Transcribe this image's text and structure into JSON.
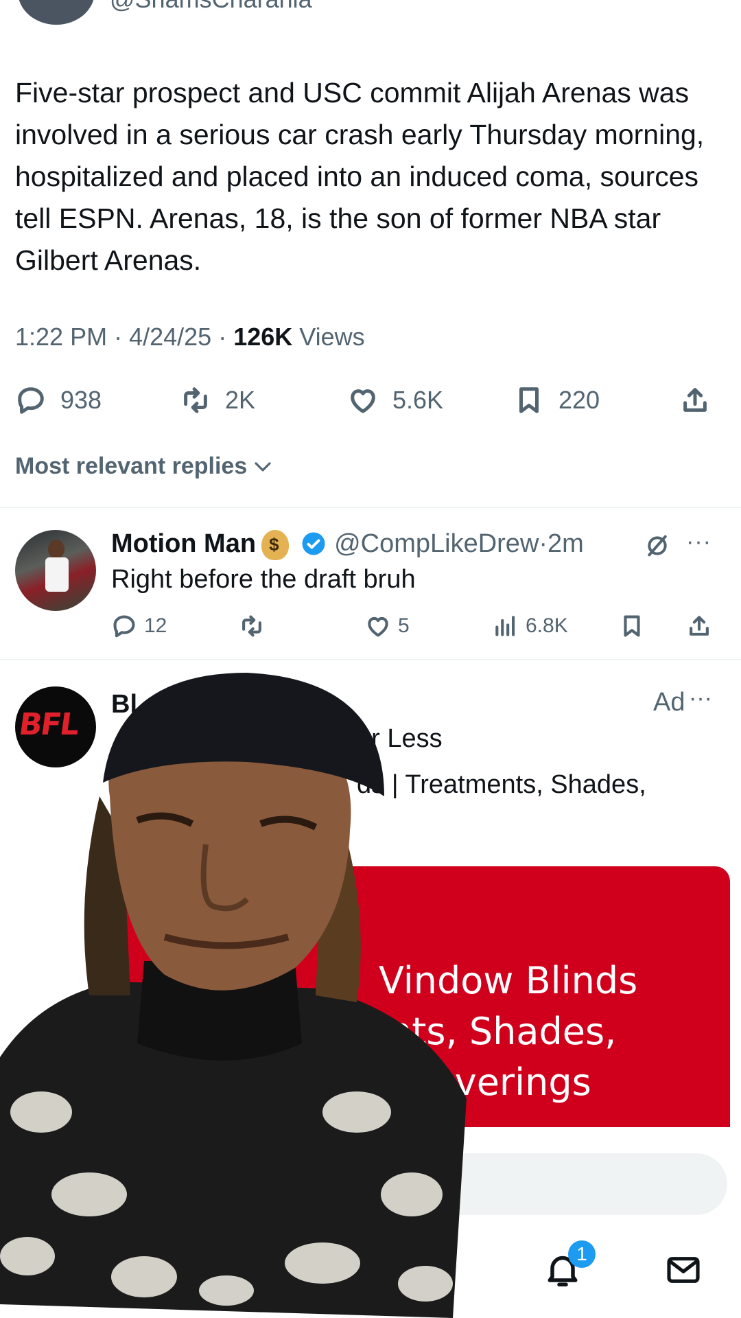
{
  "tweet": {
    "handle": "@ShamsCharania",
    "text": "Five-star prospect and USC commit Alijah Arenas was involved in a serious car crash early Thursday morning, hospitalized and placed into an induced coma, sources tell ESPN. Arenas, 18, is the son of former NBA star Gilbert Arenas.",
    "time": "1:22 PM",
    "date": "4/24/25",
    "views_count": "126K",
    "views_label": "Views",
    "replies": "938",
    "reposts": "2K",
    "likes": "5.6K",
    "bookmarks": "220"
  },
  "replies_sort": {
    "label": "Most relevant replies"
  },
  "reply": {
    "name": "Motion Man",
    "handle": "@CompLikeDrew",
    "age": "2m",
    "text": "Right before the draft bruh",
    "replies": "12",
    "likes": "5",
    "views": "6.8K"
  },
  "ad": {
    "name_partial": "Bl",
    "label": "Ad",
    "line1_partial": "or Less",
    "line2_partial": "ds | Treatments, Shades,",
    "avatar_logo": "BFL",
    "card_lines": [
      "Vindow Blinds",
      "nts, Shades,",
      "Coverings"
    ]
  },
  "nav": {
    "notifications_badge": "1"
  },
  "colors": {
    "accent": "#1d9bf0",
    "ad_card": "#d0001d",
    "secondary_text": "#536471"
  },
  "icons": [
    "reply-icon",
    "repost-icon",
    "like-icon",
    "bookmark-icon",
    "share-icon",
    "chevron-down-icon",
    "verified-icon",
    "grok-icon",
    "more-icon",
    "views-icon",
    "bell-icon",
    "mail-icon",
    "home-icon"
  ]
}
